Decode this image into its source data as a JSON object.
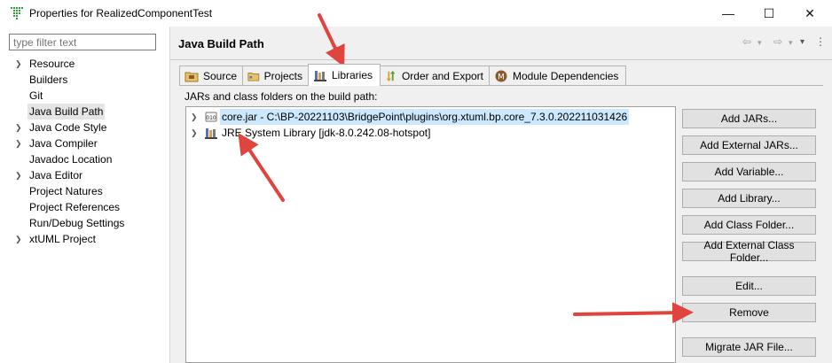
{
  "window": {
    "title": "Properties for RealizedComponentTest",
    "minimize_glyph": "—",
    "maximize_glyph": "☐",
    "close_glyph": "✕"
  },
  "left": {
    "filter_placeholder": "type filter text",
    "items": [
      {
        "label": "Resource",
        "expandable": true
      },
      {
        "label": "Builders",
        "expandable": false
      },
      {
        "label": "Git",
        "expandable": false
      },
      {
        "label": "Java Build Path",
        "expandable": false,
        "selected": true
      },
      {
        "label": "Java Code Style",
        "expandable": true
      },
      {
        "label": "Java Compiler",
        "expandable": true
      },
      {
        "label": "Javadoc Location",
        "expandable": false
      },
      {
        "label": "Java Editor",
        "expandable": true
      },
      {
        "label": "Project Natures",
        "expandable": false
      },
      {
        "label": "Project References",
        "expandable": false
      },
      {
        "label": "Run/Debug Settings",
        "expandable": false
      },
      {
        "label": "xtUML Project",
        "expandable": true
      }
    ]
  },
  "page": {
    "title": "Java Build Path",
    "nav_back": "⇦",
    "nav_forward": "⇨",
    "dropdown": "▾",
    "menu": "⋮",
    "tabs": [
      {
        "label": "Source",
        "icon": "source-folder-icon"
      },
      {
        "label": "Projects",
        "icon": "projects-icon"
      },
      {
        "label": "Libraries",
        "icon": "libraries-icon",
        "active": true
      },
      {
        "label": "Order and Export",
        "icon": "order-export-icon"
      },
      {
        "label": "Module Dependencies",
        "icon": "module-icon"
      }
    ],
    "section_label": "JARs and class folders on the build path:",
    "entries": [
      {
        "label": "core.jar - C:\\BP-20221103\\BridgePoint\\plugins\\org.xtuml.bp.core_7.3.0.202211031426",
        "icon": "jar-icon",
        "selected": true
      },
      {
        "label": "JRE System Library [jdk-8.0.242.08-hotspot]",
        "icon": "library-icon",
        "selected": false
      }
    ],
    "buttons": [
      "Add JARs...",
      "Add External JARs...",
      "Add Variable...",
      "Add Library...",
      "Add Class Folder...",
      "Add External Class Folder...",
      "Edit...",
      "Remove",
      "Migrate JAR File..."
    ]
  },
  "colors": {
    "annotation_arrow": "#e0443e",
    "selection": "#cce8ff",
    "tree_selection": "#e5e5e5",
    "button_face": "#e1e1e1"
  }
}
